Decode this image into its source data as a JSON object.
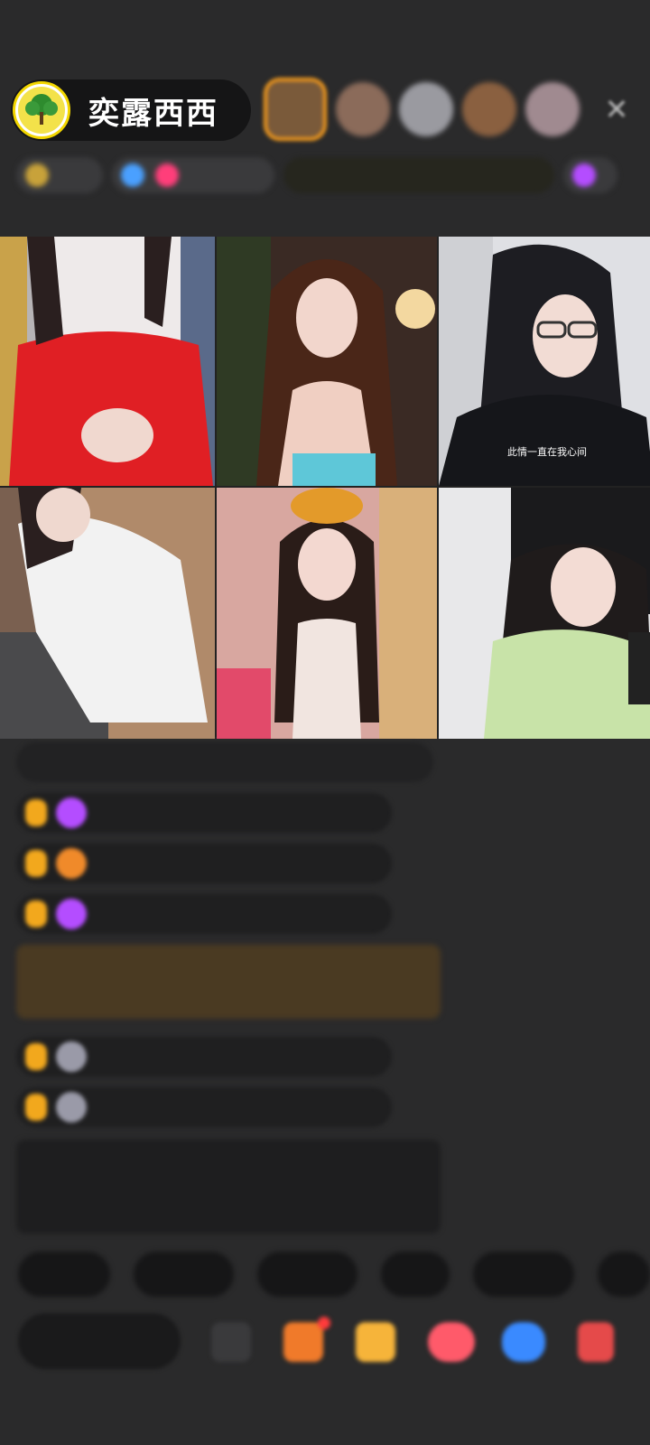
{
  "header": {
    "host_name": "奕露西西",
    "host_avatar_icon": "tree-icon",
    "close_icon": "close-icon",
    "viewer_colors": [
      "#7a5a3a",
      "#8b6b5a",
      "#9a9aa0",
      "#8a6040",
      "#a08a90"
    ]
  },
  "info_row": {
    "chips": [
      "",
      "",
      "",
      ""
    ]
  },
  "video_grid": {
    "tiles": [
      {
        "caption": ""
      },
      {
        "caption": ""
      },
      {
        "caption": "此情一直在我心间"
      },
      {
        "caption": ""
      },
      {
        "caption": ""
      },
      {
        "caption": ""
      }
    ]
  },
  "chat": {
    "messages": [
      {
        "badge": "",
        "user": "",
        "text": ""
      },
      {
        "badge": "",
        "user": "",
        "text": ""
      },
      {
        "badge": "",
        "user": "",
        "text": ""
      },
      {
        "badge": "",
        "user": "",
        "text": ""
      },
      {
        "badge": "",
        "user": "",
        "text": ""
      },
      {
        "badge": "",
        "user": "",
        "text": ""
      },
      {
        "badge": "",
        "user": "",
        "text": ""
      }
    ],
    "system_message": "",
    "notice": ""
  },
  "quick_replies": [
    "",
    "",
    "",
    "",
    "",
    ""
  ],
  "bottom_bar": {
    "input_placeholder": "",
    "icons": [
      "emoji-icon",
      "gift-box-icon",
      "treasure-chest-icon",
      "heart-gift-icon",
      "game-icon",
      "more-icon"
    ]
  },
  "colors": {
    "background": "#2a2a2b",
    "badge": "#f2a81d",
    "accent_purple": "#b44dff",
    "notice_green": "#a7d96b"
  }
}
